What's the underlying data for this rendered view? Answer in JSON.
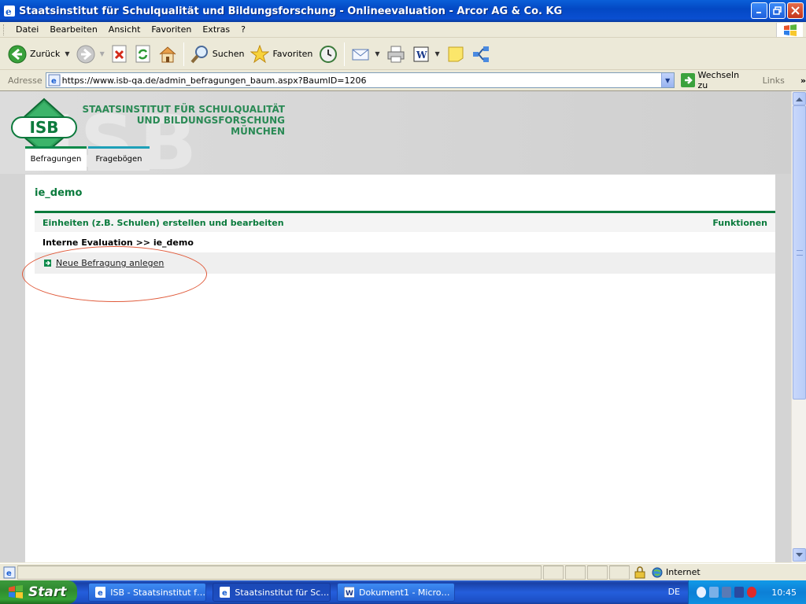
{
  "window": {
    "title": "Staatsinstitut für Schulqualität und Bildungsforschung - Onlineevaluation - Arcor AG & Co. KG"
  },
  "menu": [
    "Datei",
    "Bearbeiten",
    "Ansicht",
    "Favoriten",
    "Extras",
    "?"
  ],
  "toolbar": {
    "back": "Zurück",
    "search": "Suchen",
    "favorites": "Favoriten"
  },
  "address": {
    "label": "Adresse",
    "url": "https://www.isb-qa.de/admin_befragungen_baum.aspx?BaumID=1206",
    "go": "Wechseln zu",
    "links": "Links"
  },
  "site": {
    "logo_text": "ISB",
    "institute_line1": "STAATSINSTITUT FÜR SCHULQUALITÄT",
    "institute_line2": "UND BILDUNGSFORSCHUNG",
    "institute_line3": "MÜNCHEN",
    "tabs": [
      "Befragungen",
      "Fragebögen"
    ],
    "page_title": "ie_demo",
    "section_title": "Einheiten (z.B. Schulen) erstellen und bearbeiten",
    "section_functions": "Funktionen",
    "breadcrumb": "Interne Evaluation  >>  ie_demo",
    "action_link": "Neue Befragung anlegen"
  },
  "statusbar": {
    "zone": "Internet"
  },
  "taskbar": {
    "start": "Start",
    "tasks": [
      "ISB - Staatsinstitut fü...",
      "Staatsinstitut für Sch...",
      "Dokument1 - Microsof..."
    ],
    "language": "DE",
    "clock": "10:45"
  },
  "colors": {
    "isb_green": "#0d7a3d",
    "tab_teal": "#1ea0b8",
    "annotation": "#e05a3a",
    "xp_blue": "#0a4fd1"
  }
}
